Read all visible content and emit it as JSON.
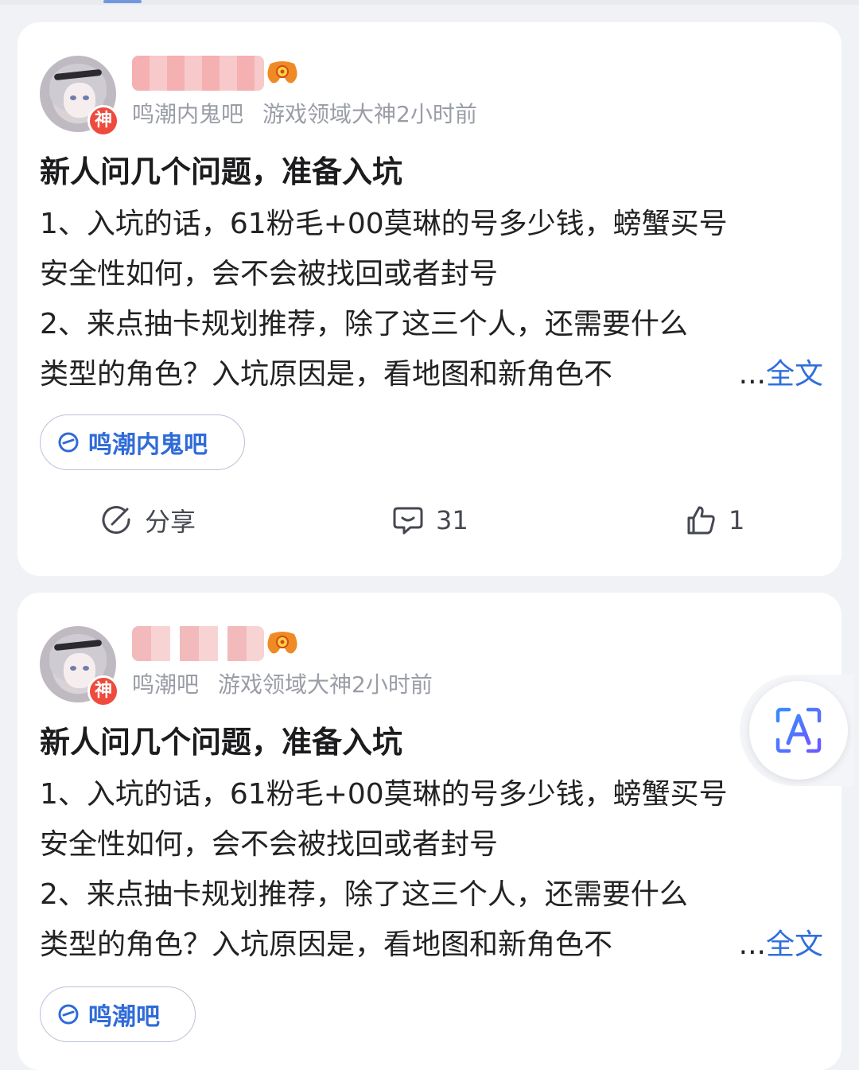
{
  "posts": [
    {
      "avatar_badge": "神",
      "meta": {
        "forum": "鸣潮内鬼吧",
        "title_time": "游戏领域大神2小时前"
      },
      "title": "新人问几个问题，准备入坑",
      "lines": [
        "1、入坑的话，61粉毛+00莫琳的号多少钱，螃蟹买号",
        "安全性如何，会不会被找回或者封号",
        "2、来点抽卡规划推荐，除了这三个人，还需要什么",
        "类型的角色？入坑原因是，看地图和新角色不"
      ],
      "ellipsis": "...",
      "full_text": "全文",
      "forum_tag": "鸣潮内鬼吧",
      "actions": {
        "share": "分享",
        "comments": "31",
        "likes": "1"
      }
    },
    {
      "avatar_badge": "神",
      "meta": {
        "forum": "鸣潮吧",
        "title_time": "游戏领域大神2小时前"
      },
      "title": "新人问几个问题，准备入坑",
      "lines": [
        "1、入坑的话，61粉毛+00莫琳的号多少钱，螃蟹买号",
        "安全性如何，会不会被找回或者封号",
        "2、来点抽卡规划推荐，除了这三个人，还需要什么",
        "类型的角色？入坑原因是，看地图和新角色不"
      ],
      "ellipsis": "...",
      "full_text": "全文",
      "forum_tag": "鸣潮吧"
    }
  ],
  "colors": {
    "accent": "#2f6fdc",
    "badge": "#ee4b3e",
    "background": "#f1f2f6"
  },
  "icons": [
    "gamepad-icon",
    "forum-tag-icon",
    "share-icon",
    "comment-icon",
    "like-icon",
    "text-recognition-icon"
  ]
}
